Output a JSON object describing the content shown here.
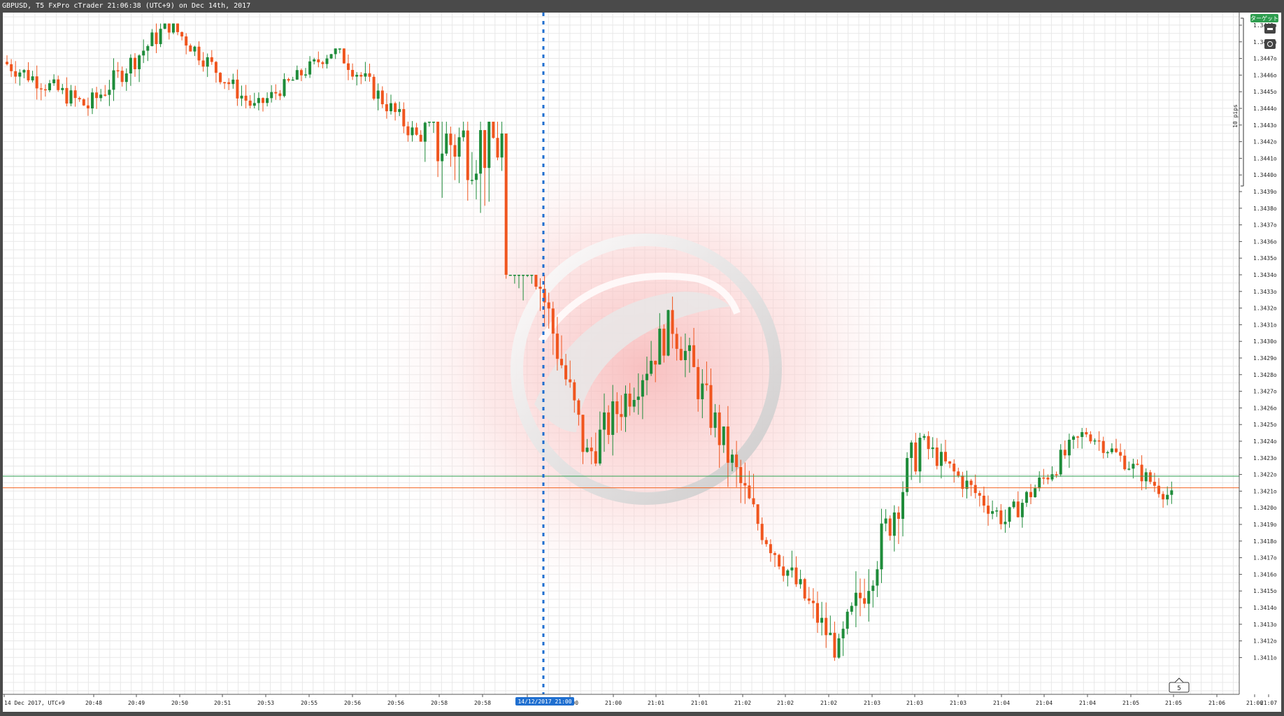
{
  "window": {
    "title": "GBPUSD, T5 FxPro cTrader 21:06:38 (UTC+9) on Dec 14th, 2017"
  },
  "chart_data": {
    "type": "candlestick",
    "symbol": "GBPUSD",
    "ylim": [
      1.34104,
      1.34492
    ],
    "y_ticks": [
      "1.3411o",
      "1.3412o",
      "1.3413o",
      "1.3414o",
      "1.3415o",
      "1.3416o",
      "1.3417o",
      "1.3418o",
      "1.3419o",
      "1.3420o",
      "1.3421o",
      "1.3422o",
      "1.3423o",
      "1.3424o",
      "1.3425o",
      "1.3426o",
      "1.3427o",
      "1.3428o",
      "1.3429o",
      "1.3430o",
      "1.3431o",
      "1.3432o",
      "1.3433o",
      "1.3434o",
      "1.3435o",
      "1.3436o",
      "1.3437o",
      "1.3438o",
      "1.3439o",
      "1.3440o",
      "1.3441o",
      "1.3442o",
      "1.3443o",
      "1.3444o",
      "1.3445o",
      "1.3446o",
      "1.3447o",
      "1.3448o",
      "1.3449o"
    ],
    "x_ticks": [
      "14 Dec 2017, UTC+9",
      "20:48",
      "20:49",
      "20:50",
      "20:51",
      "20:53",
      "20:55",
      "20:56",
      "20:56",
      "20:58",
      "20:58",
      "21:00",
      "21:00",
      "21:00",
      "21:01",
      "21:01",
      "21:02",
      "21:02",
      "21:02",
      "21:03",
      "21:03",
      "21:03",
      "21:04",
      "21:04",
      "21:04",
      "21:05",
      "21:05",
      "21:06",
      "21:06",
      "21:07"
    ],
    "crosshair_label": "14/12/2017 21:00",
    "ask_line": {
      "value": 1.34219,
      "label": "1.34219",
      "color": "#2e9e4f"
    },
    "bid_line": {
      "value": 1.34212,
      "label": "1.34212",
      "color": "#f26522"
    },
    "scale_label": "10 pips",
    "target_label": "ターゲット",
    "zoom_label": "5",
    "colors": {
      "up": "#1e8c3a",
      "down": "#f0551e",
      "grid": "#e8e8e8"
    },
    "ticks_per_candle": "5",
    "series": [
      {
        "name": "segment-1",
        "start": 1.34468,
        "end": 1.34441,
        "min": 1.34421,
        "max": 1.34474
      },
      {
        "name": "segment-2",
        "start": 1.34441,
        "end": 1.34491,
        "min": 1.3443,
        "max": 1.34491
      },
      {
        "name": "segment-3",
        "start": 1.34491,
        "end": 1.3444,
        "min": 1.3444,
        "max": 1.34491
      },
      {
        "name": "segment-4",
        "start": 1.3444,
        "end": 1.34476,
        "min": 1.34438,
        "max": 1.34476
      },
      {
        "name": "segment-5",
        "start": 1.34476,
        "end": 1.3442,
        "min": 1.3442,
        "max": 1.34476
      },
      {
        "name": "segment-6",
        "start": 1.3442,
        "end": 1.34419,
        "min": 1.34193,
        "max": 1.34432
      },
      {
        "name": "segment-7",
        "start": 1.34419,
        "end": 1.3423,
        "min": 1.342,
        "max": 1.3434
      },
      {
        "name": "segment-8",
        "start": 1.3423,
        "end": 1.34311,
        "min": 1.34225,
        "max": 1.34346
      },
      {
        "name": "segment-9",
        "start": 1.34311,
        "end": 1.34195,
        "min": 1.34185,
        "max": 1.34311
      },
      {
        "name": "segment-10",
        "start": 1.34195,
        "end": 1.34113,
        "min": 1.34108,
        "max": 1.34195
      },
      {
        "name": "segment-11",
        "start": 1.34113,
        "end": 1.3424,
        "min": 1.34108,
        "max": 1.34245
      },
      {
        "name": "segment-12",
        "start": 1.3424,
        "end": 1.34192,
        "min": 1.34185,
        "max": 1.34246
      },
      {
        "name": "segment-13",
        "start": 1.34192,
        "end": 1.34246,
        "min": 1.34188,
        "max": 1.34248
      },
      {
        "name": "segment-14",
        "start": 1.34246,
        "end": 1.34206,
        "min": 1.342,
        "max": 1.34246
      }
    ]
  }
}
